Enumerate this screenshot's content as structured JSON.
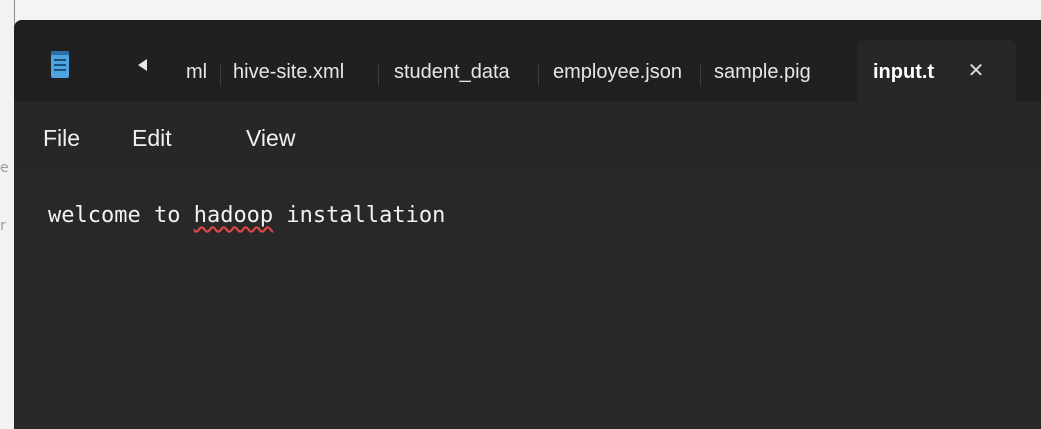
{
  "backdrop": {
    "ghost_chars": [
      "e",
      "r"
    ]
  },
  "window": {
    "app_icon": "notepad-icon",
    "tabs": [
      {
        "label": "ml"
      },
      {
        "label": "hive-site.xml"
      },
      {
        "label": "student_data"
      },
      {
        "label": "employee.json"
      },
      {
        "label": "sample.pig"
      }
    ],
    "active_tab": {
      "label": "input.txt",
      "close_glyph": "✕"
    },
    "scroll_left_icon": "caret-left-icon"
  },
  "menu": {
    "file": "File",
    "edit": "Edit",
    "view": "View"
  },
  "editor": {
    "text_before": "welcome to ",
    "misspelled": "hadoop",
    "text_after": " installation"
  },
  "colors": {
    "titlebar": "#202020",
    "editor_bg": "#282828",
    "spell_underline": "#e04848"
  }
}
